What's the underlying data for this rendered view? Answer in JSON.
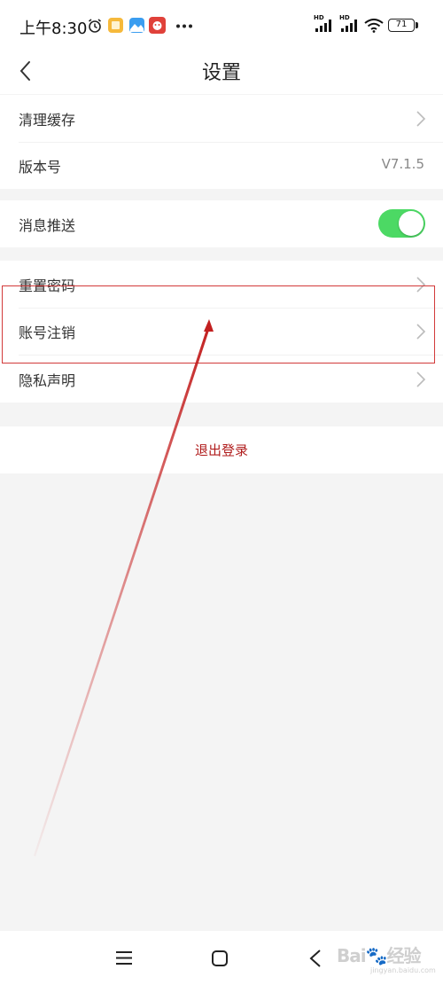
{
  "status_bar": {
    "time": "上午8:30",
    "signal_1_label": "HD",
    "signal_2_label": "HD",
    "battery": "71",
    "icons": [
      "alarm-icon",
      "notes-app-icon",
      "gallery-app-icon",
      "game-app-icon",
      "more-dots-icon",
      "signal-icon",
      "signal-icon",
      "wifi-icon",
      "battery-icon"
    ]
  },
  "header": {
    "title": "设置",
    "back_icon": "chevron-left-icon"
  },
  "settings": {
    "clear_cache": {
      "label": "清理缓存"
    },
    "version": {
      "label": "版本号",
      "value": "V7.1.5"
    },
    "push": {
      "label": "消息推送",
      "enabled": true
    },
    "reset_password": {
      "label": "重置密码"
    },
    "cancel_account": {
      "label": "账号注销"
    },
    "privacy": {
      "label": "隐私声明"
    }
  },
  "logout": {
    "label": "退出登录"
  },
  "bottom_nav": {
    "icons": [
      "menu-icon",
      "home-square-icon",
      "back-triangle-icon"
    ]
  },
  "watermark": {
    "text": "Baidu 经验",
    "sub": "jingyan.baidu.com"
  },
  "colors": {
    "accent_red": "#b01c1c",
    "toggle_green": "#4cd964",
    "annotation_red": "#d23a3a"
  }
}
